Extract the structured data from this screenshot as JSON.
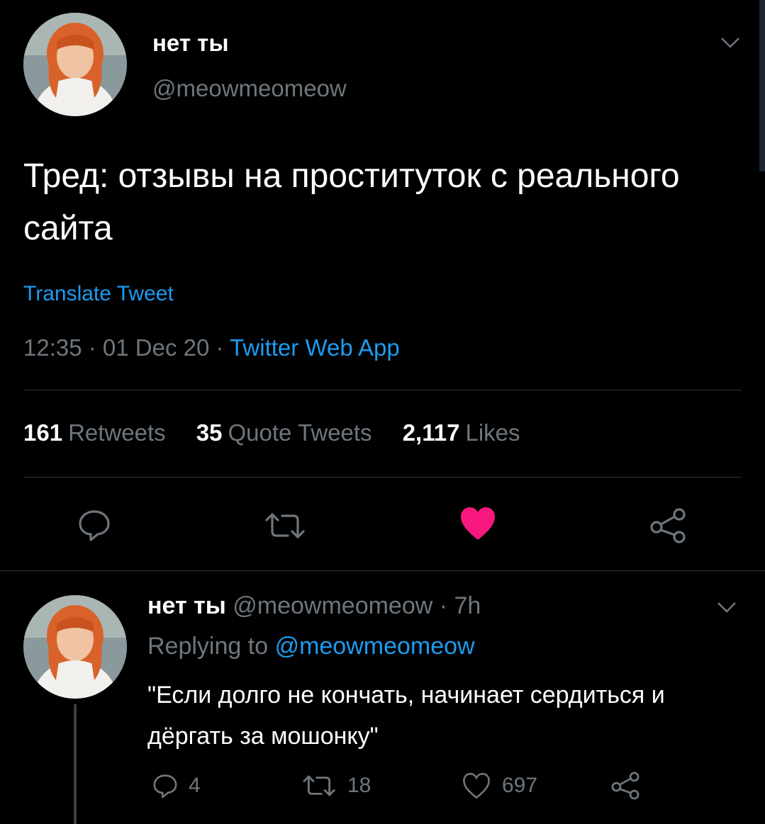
{
  "tweet": {
    "author": {
      "display_name": "нет ты",
      "handle": "@meowmeomeow",
      "avatar_icon": "avatar-photo"
    },
    "text": "Тред: отзывы на проституток с реального сайта",
    "translate_label": "Translate Tweet",
    "time": "12:35",
    "date": "01 Dec 20",
    "separator": " · ",
    "source": "Twitter Web App",
    "stats": {
      "retweets": {
        "count": "161",
        "label": "Retweets"
      },
      "quote_tweets": {
        "count": "35",
        "label": "Quote Tweets"
      },
      "likes": {
        "count": "2,117",
        "label": "Likes"
      }
    },
    "actions": [
      "reply-icon",
      "retweet-icon",
      "like-icon-filled",
      "share-icon"
    ],
    "liked": true
  },
  "reply": {
    "author": {
      "display_name": "нет ты",
      "handle": "@meowmeomeow",
      "age": "7h",
      "separator": " · "
    },
    "replying_prefix": "Replying to",
    "replying_to": "@meowmeomeow",
    "text": "\"Если долго не кончать, начинает сердиться и дёргать за мошонку\"",
    "counts": {
      "replies": "4",
      "retweets": "18",
      "likes": "697"
    }
  },
  "colors": {
    "background": "#000000",
    "text": "#ffffff",
    "muted": "#6e767d",
    "link": "#1d9bf0",
    "like": "#f91880",
    "divider": "#2f3336"
  }
}
